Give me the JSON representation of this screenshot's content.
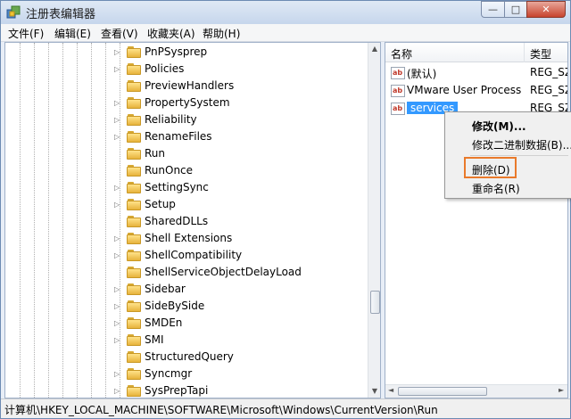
{
  "window": {
    "title": "注册表编辑器",
    "controls": {
      "minimize": "—",
      "maximize": "□",
      "close": "✕"
    }
  },
  "menubar": [
    {
      "label": "文件(F)"
    },
    {
      "label": "编辑(E)"
    },
    {
      "label": "查看(V)"
    },
    {
      "label": "收藏夹(A)"
    },
    {
      "label": "帮助(H)"
    }
  ],
  "tree": {
    "items": [
      {
        "label": "PnPSysprep",
        "expandable": true
      },
      {
        "label": "Policies",
        "expandable": true
      },
      {
        "label": "PreviewHandlers",
        "expandable": false
      },
      {
        "label": "PropertySystem",
        "expandable": true
      },
      {
        "label": "Reliability",
        "expandable": true
      },
      {
        "label": "RenameFiles",
        "expandable": true
      },
      {
        "label": "Run",
        "expandable": false
      },
      {
        "label": "RunOnce",
        "expandable": false
      },
      {
        "label": "SettingSync",
        "expandable": true
      },
      {
        "label": "Setup",
        "expandable": true
      },
      {
        "label": "SharedDLLs",
        "expandable": false
      },
      {
        "label": "Shell Extensions",
        "expandable": true
      },
      {
        "label": "ShellCompatibility",
        "expandable": true
      },
      {
        "label": "ShellServiceObjectDelayLoad",
        "expandable": false
      },
      {
        "label": "Sidebar",
        "expandable": true
      },
      {
        "label": "SideBySide",
        "expandable": true
      },
      {
        "label": "SMDEn",
        "expandable": true
      },
      {
        "label": "SMI",
        "expandable": true
      },
      {
        "label": "StructuredQuery",
        "expandable": false
      },
      {
        "label": "Syncmgr",
        "expandable": true
      },
      {
        "label": "SysPrepTapi",
        "expandable": true
      }
    ]
  },
  "list": {
    "columns": {
      "name": "名称",
      "type": "类型"
    },
    "rows": [
      {
        "icon": "ab",
        "name": "(默认)",
        "type": "REG_SZ"
      },
      {
        "icon": "ab",
        "name": "VMware User Process",
        "type": "REG_SZ"
      },
      {
        "icon": "ab",
        "name": "services",
        "type": "REG_SZ",
        "selected": true
      }
    ]
  },
  "context_menu": {
    "items": [
      {
        "label": "修改(M)...",
        "bold": true
      },
      {
        "label": "修改二进制数据(B)..."
      },
      {
        "label": "删除(D)",
        "highlighted": true
      },
      {
        "label": "重命名(R)"
      }
    ]
  },
  "statusbar": {
    "path": "计算机\\HKEY_LOCAL_MACHINE\\SOFTWARE\\Microsoft\\Windows\\CurrentVersion\\Run"
  },
  "colors": {
    "selection": "#3399ff",
    "highlight_box": "#e97a2b"
  }
}
